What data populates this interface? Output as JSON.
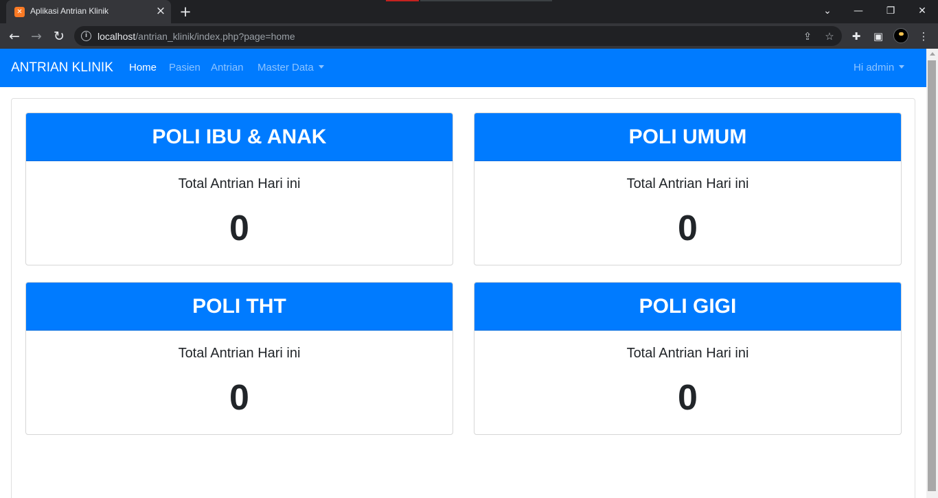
{
  "browser": {
    "tab_title": "Aplikasi Antrian Klinik",
    "url_host": "localhost",
    "url_path": "/antrian_klinik/index.php?page=home"
  },
  "navbar": {
    "brand": "ANTRIAN KLINIK",
    "links": [
      {
        "label": "Home",
        "active": true
      },
      {
        "label": "Pasien",
        "active": false
      },
      {
        "label": "Antrian",
        "active": false
      },
      {
        "label": "Master Data",
        "active": false,
        "dropdown": true
      }
    ],
    "user_menu": "Hi admin"
  },
  "cards": [
    {
      "title": "POLI IBU & ANAK",
      "subtitle": "Total Antrian Hari ini",
      "count": "0"
    },
    {
      "title": "POLI UMUM",
      "subtitle": "Total Antrian Hari ini",
      "count": "0"
    },
    {
      "title": "POLI THT",
      "subtitle": "Total Antrian Hari ini",
      "count": "0"
    },
    {
      "title": "POLI GIGI",
      "subtitle": "Total Antrian Hari ini",
      "count": "0"
    }
  ],
  "colors": {
    "primary": "#007bff",
    "text": "#212529"
  }
}
